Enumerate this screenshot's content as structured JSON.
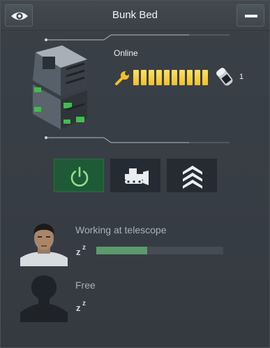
{
  "window": {
    "title": "Bunk Bed"
  },
  "titlebar": {
    "visibility_icon": "eye-icon",
    "minimize_icon": "minus-icon"
  },
  "block": {
    "status": "Online",
    "integrity_segments_filled": 10,
    "integrity_segments_total": 10,
    "component_count": "1"
  },
  "actions": [
    {
      "name": "power",
      "icon": "power-icon",
      "active": true
    },
    {
      "name": "bulldoze",
      "icon": "bulldozer-icon",
      "active": false
    },
    {
      "name": "upgrade",
      "icon": "chevrons-up-icon",
      "active": false
    }
  ],
  "occupants": [
    {
      "activity": "Working at telescope",
      "progress": 0.4,
      "sleep_icon": "sleep-zz-icon"
    },
    {
      "activity": "Free",
      "sleep_icon": "sleep-zz-icon"
    }
  ],
  "colors": {
    "power_active": "#1f5a36",
    "power_glyph": "#8ee08f",
    "integrity": "#f2c025",
    "progress": "#5c9a6d"
  }
}
